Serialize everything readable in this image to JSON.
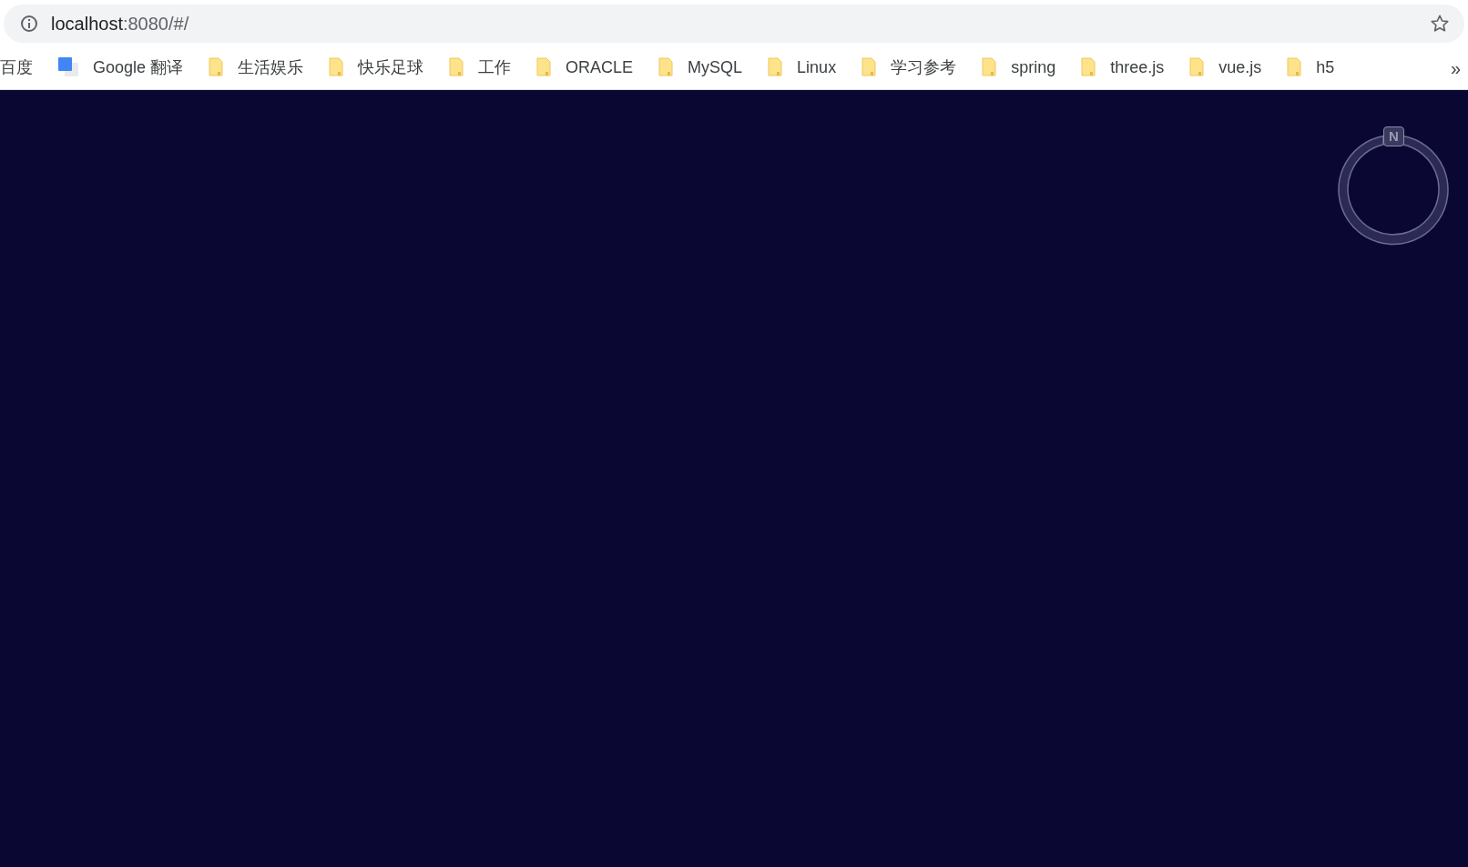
{
  "address_bar": {
    "host": "localhost",
    "path": ":8080/#/"
  },
  "bookmarks": [
    {
      "label": "百度",
      "kind": "cut"
    },
    {
      "label": "Google 翻译",
      "kind": "translate"
    },
    {
      "label": "生活娱乐",
      "kind": "folder"
    },
    {
      "label": "快乐足球",
      "kind": "folder"
    },
    {
      "label": "工作",
      "kind": "folder"
    },
    {
      "label": "ORACLE",
      "kind": "folder"
    },
    {
      "label": "MySQL",
      "kind": "folder"
    },
    {
      "label": "Linux",
      "kind": "folder"
    },
    {
      "label": "学习参考",
      "kind": "folder"
    },
    {
      "label": "spring",
      "kind": "folder"
    },
    {
      "label": "three.js",
      "kind": "folder"
    },
    {
      "label": "vue.js",
      "kind": "folder"
    },
    {
      "label": "h5",
      "kind": "folder"
    }
  ],
  "bookmarks_overflow": "»",
  "compass": {
    "north_label": "N"
  }
}
